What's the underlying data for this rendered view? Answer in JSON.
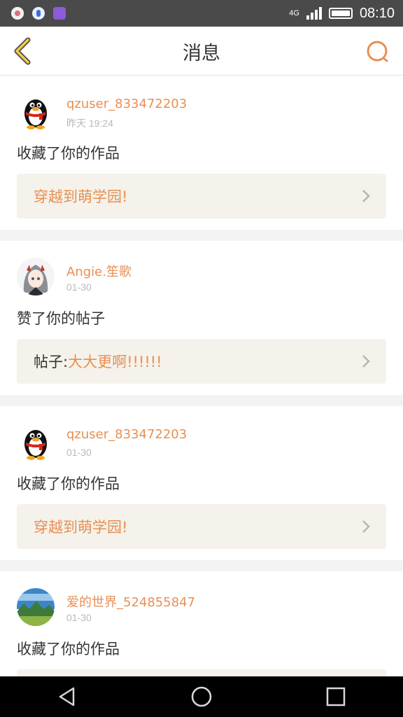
{
  "status_bar": {
    "network": "4G",
    "time": "08:10"
  },
  "header": {
    "title": "消息"
  },
  "colors": {
    "accent": "#e98f52",
    "link_box_bg": "#f4f2ea",
    "status_bar_bg": "#4a4a4a"
  },
  "notifications": [
    {
      "username": "qzuser_833472203",
      "time": "昨天 19:24",
      "action": "收藏了你的作品",
      "link_prefix": "",
      "link_text": "穿越到萌学园!",
      "avatar_icon": "qq-penguin-avatar"
    },
    {
      "username": "Angie.笙歌",
      "time": "01-30",
      "action": "赞了你的帖子",
      "link_prefix": "帖子:",
      "link_text": "大大更啊!!!!!!",
      "avatar_icon": "anime-girl-avatar"
    },
    {
      "username": "qzuser_833472203",
      "time": "01-30",
      "action": "收藏了你的作品",
      "link_prefix": "",
      "link_text": "穿越到萌学园!",
      "avatar_icon": "qq-penguin-avatar"
    },
    {
      "username": "爱的世界_524855847",
      "time": "01-30",
      "action": "收藏了你的作品",
      "link_prefix": "",
      "link_text": "",
      "avatar_icon": "landscape-avatar"
    }
  ]
}
